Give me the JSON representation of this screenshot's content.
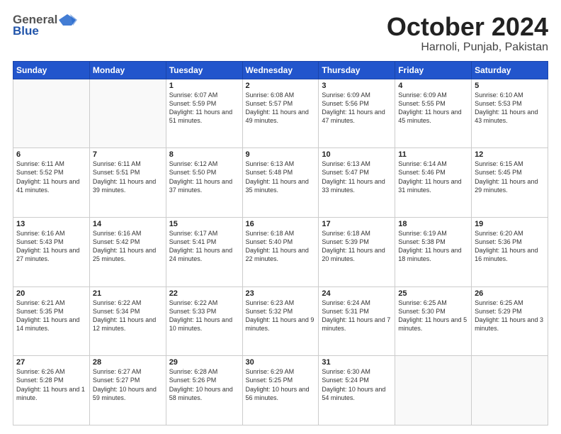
{
  "header": {
    "logo_general": "General",
    "logo_blue": "Blue",
    "title": "October 2024",
    "subtitle": "Harnoli, Punjab, Pakistan"
  },
  "days_of_week": [
    "Sunday",
    "Monday",
    "Tuesday",
    "Wednesday",
    "Thursday",
    "Friday",
    "Saturday"
  ],
  "weeks": [
    [
      {
        "day": "",
        "sunrise": "",
        "sunset": "",
        "daylight": ""
      },
      {
        "day": "",
        "sunrise": "",
        "sunset": "",
        "daylight": ""
      },
      {
        "day": "1",
        "sunrise": "Sunrise: 6:07 AM",
        "sunset": "Sunset: 5:59 PM",
        "daylight": "Daylight: 11 hours and 51 minutes."
      },
      {
        "day": "2",
        "sunrise": "Sunrise: 6:08 AM",
        "sunset": "Sunset: 5:57 PM",
        "daylight": "Daylight: 11 hours and 49 minutes."
      },
      {
        "day": "3",
        "sunrise": "Sunrise: 6:09 AM",
        "sunset": "Sunset: 5:56 PM",
        "daylight": "Daylight: 11 hours and 47 minutes."
      },
      {
        "day": "4",
        "sunrise": "Sunrise: 6:09 AM",
        "sunset": "Sunset: 5:55 PM",
        "daylight": "Daylight: 11 hours and 45 minutes."
      },
      {
        "day": "5",
        "sunrise": "Sunrise: 6:10 AM",
        "sunset": "Sunset: 5:53 PM",
        "daylight": "Daylight: 11 hours and 43 minutes."
      }
    ],
    [
      {
        "day": "6",
        "sunrise": "Sunrise: 6:11 AM",
        "sunset": "Sunset: 5:52 PM",
        "daylight": "Daylight: 11 hours and 41 minutes."
      },
      {
        "day": "7",
        "sunrise": "Sunrise: 6:11 AM",
        "sunset": "Sunset: 5:51 PM",
        "daylight": "Daylight: 11 hours and 39 minutes."
      },
      {
        "day": "8",
        "sunrise": "Sunrise: 6:12 AM",
        "sunset": "Sunset: 5:50 PM",
        "daylight": "Daylight: 11 hours and 37 minutes."
      },
      {
        "day": "9",
        "sunrise": "Sunrise: 6:13 AM",
        "sunset": "Sunset: 5:48 PM",
        "daylight": "Daylight: 11 hours and 35 minutes."
      },
      {
        "day": "10",
        "sunrise": "Sunrise: 6:13 AM",
        "sunset": "Sunset: 5:47 PM",
        "daylight": "Daylight: 11 hours and 33 minutes."
      },
      {
        "day": "11",
        "sunrise": "Sunrise: 6:14 AM",
        "sunset": "Sunset: 5:46 PM",
        "daylight": "Daylight: 11 hours and 31 minutes."
      },
      {
        "day": "12",
        "sunrise": "Sunrise: 6:15 AM",
        "sunset": "Sunset: 5:45 PM",
        "daylight": "Daylight: 11 hours and 29 minutes."
      }
    ],
    [
      {
        "day": "13",
        "sunrise": "Sunrise: 6:16 AM",
        "sunset": "Sunset: 5:43 PM",
        "daylight": "Daylight: 11 hours and 27 minutes."
      },
      {
        "day": "14",
        "sunrise": "Sunrise: 6:16 AM",
        "sunset": "Sunset: 5:42 PM",
        "daylight": "Daylight: 11 hours and 25 minutes."
      },
      {
        "day": "15",
        "sunrise": "Sunrise: 6:17 AM",
        "sunset": "Sunset: 5:41 PM",
        "daylight": "Daylight: 11 hours and 24 minutes."
      },
      {
        "day": "16",
        "sunrise": "Sunrise: 6:18 AM",
        "sunset": "Sunset: 5:40 PM",
        "daylight": "Daylight: 11 hours and 22 minutes."
      },
      {
        "day": "17",
        "sunrise": "Sunrise: 6:18 AM",
        "sunset": "Sunset: 5:39 PM",
        "daylight": "Daylight: 11 hours and 20 minutes."
      },
      {
        "day": "18",
        "sunrise": "Sunrise: 6:19 AM",
        "sunset": "Sunset: 5:38 PM",
        "daylight": "Daylight: 11 hours and 18 minutes."
      },
      {
        "day": "19",
        "sunrise": "Sunrise: 6:20 AM",
        "sunset": "Sunset: 5:36 PM",
        "daylight": "Daylight: 11 hours and 16 minutes."
      }
    ],
    [
      {
        "day": "20",
        "sunrise": "Sunrise: 6:21 AM",
        "sunset": "Sunset: 5:35 PM",
        "daylight": "Daylight: 11 hours and 14 minutes."
      },
      {
        "day": "21",
        "sunrise": "Sunrise: 6:22 AM",
        "sunset": "Sunset: 5:34 PM",
        "daylight": "Daylight: 11 hours and 12 minutes."
      },
      {
        "day": "22",
        "sunrise": "Sunrise: 6:22 AM",
        "sunset": "Sunset: 5:33 PM",
        "daylight": "Daylight: 11 hours and 10 minutes."
      },
      {
        "day": "23",
        "sunrise": "Sunrise: 6:23 AM",
        "sunset": "Sunset: 5:32 PM",
        "daylight": "Daylight: 11 hours and 9 minutes."
      },
      {
        "day": "24",
        "sunrise": "Sunrise: 6:24 AM",
        "sunset": "Sunset: 5:31 PM",
        "daylight": "Daylight: 11 hours and 7 minutes."
      },
      {
        "day": "25",
        "sunrise": "Sunrise: 6:25 AM",
        "sunset": "Sunset: 5:30 PM",
        "daylight": "Daylight: 11 hours and 5 minutes."
      },
      {
        "day": "26",
        "sunrise": "Sunrise: 6:25 AM",
        "sunset": "Sunset: 5:29 PM",
        "daylight": "Daylight: 11 hours and 3 minutes."
      }
    ],
    [
      {
        "day": "27",
        "sunrise": "Sunrise: 6:26 AM",
        "sunset": "Sunset: 5:28 PM",
        "daylight": "Daylight: 11 hours and 1 minute."
      },
      {
        "day": "28",
        "sunrise": "Sunrise: 6:27 AM",
        "sunset": "Sunset: 5:27 PM",
        "daylight": "Daylight: 10 hours and 59 minutes."
      },
      {
        "day": "29",
        "sunrise": "Sunrise: 6:28 AM",
        "sunset": "Sunset: 5:26 PM",
        "daylight": "Daylight: 10 hours and 58 minutes."
      },
      {
        "day": "30",
        "sunrise": "Sunrise: 6:29 AM",
        "sunset": "Sunset: 5:25 PM",
        "daylight": "Daylight: 10 hours and 56 minutes."
      },
      {
        "day": "31",
        "sunrise": "Sunrise: 6:30 AM",
        "sunset": "Sunset: 5:24 PM",
        "daylight": "Daylight: 10 hours and 54 minutes."
      },
      {
        "day": "",
        "sunrise": "",
        "sunset": "",
        "daylight": ""
      },
      {
        "day": "",
        "sunrise": "",
        "sunset": "",
        "daylight": ""
      }
    ]
  ]
}
